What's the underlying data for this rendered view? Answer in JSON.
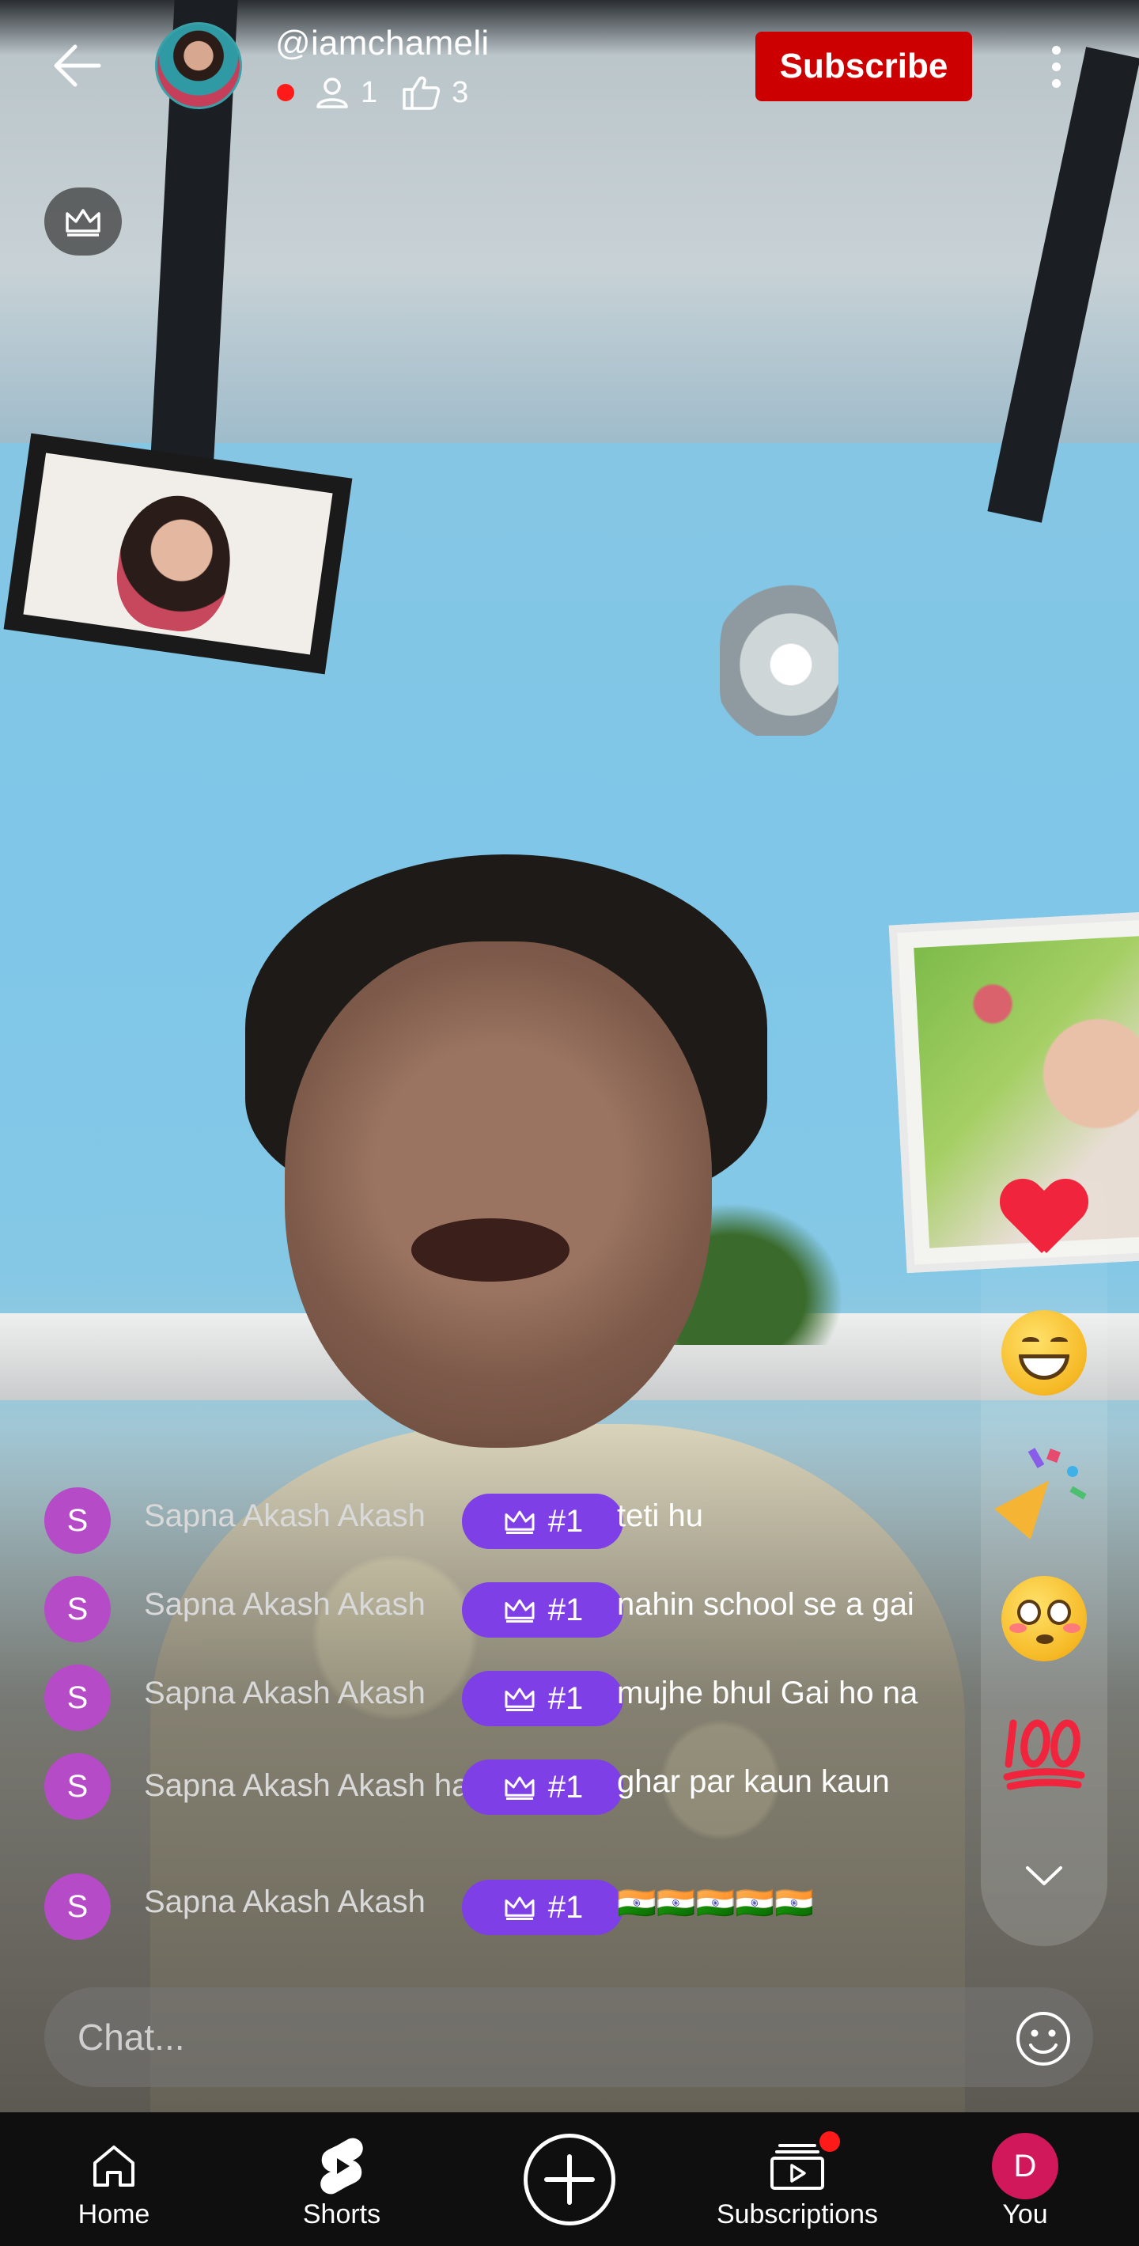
{
  "header": {
    "channel_name": "@iamchameli",
    "viewers": "1",
    "likes": "3",
    "subscribe_label": "Subscribe",
    "live_color": "#ff1a1a",
    "subscribe_color": "#cc0000"
  },
  "chat": {
    "messages": [
      {
        "initial": "S",
        "author": "Sapna Akash Akash",
        "badge": "#1",
        "text": "teti hu"
      },
      {
        "initial": "S",
        "author": "Sapna Akash Akash",
        "badge": "#1",
        "text": "nahin school se a gai"
      },
      {
        "initial": "S",
        "author": "Sapna Akash Akash",
        "badge": "#1",
        "text": "mujhe bhul Gai ho na"
      },
      {
        "initial": "S",
        "author": "Sapna Akash Akash hai",
        "badge": "#1",
        "text": "ghar par kaun kaun"
      },
      {
        "initial": "S",
        "author": "Sapna Akash Akash",
        "badge": "#1",
        "text": "🇮🇳🇮🇳🇮🇳🇮🇳🇮🇳"
      }
    ],
    "badge_color": "#7f3fe6",
    "avatar_color": "#b64bc7",
    "input_placeholder": "Chat..."
  },
  "reactions": [
    "heart-emoji",
    "grinning-face-emoji",
    "party-popper-emoji",
    "flushed-face-emoji",
    "hundred-points-emoji"
  ],
  "bottom_nav": {
    "home": "Home",
    "shorts": "Shorts",
    "subscriptions": "Subscriptions",
    "you": "You",
    "you_initial": "D",
    "you_avatar_color": "#d1185b"
  }
}
